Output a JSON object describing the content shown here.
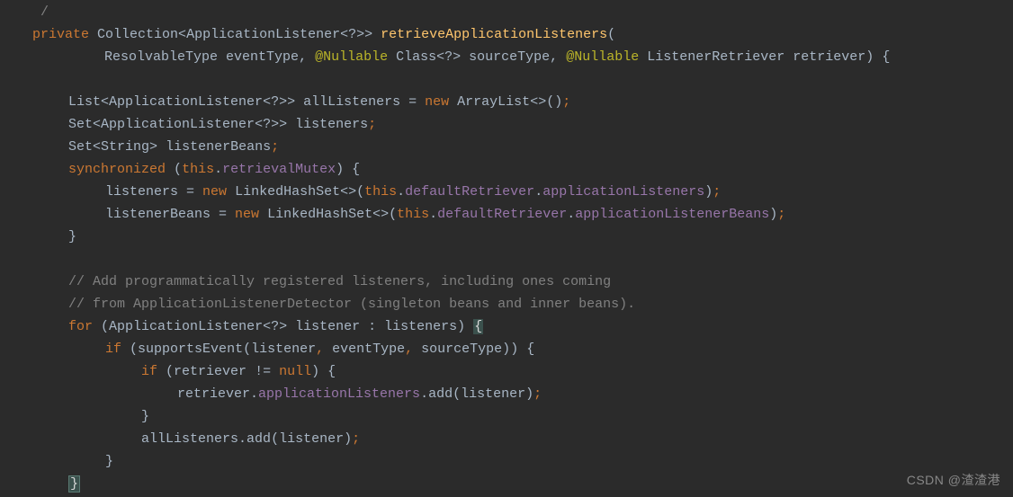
{
  "watermark": "CSDN @渣渣港",
  "tokens": {
    "private": "private",
    "new": "new",
    "this": "this",
    "synchronized": "synchronized",
    "for": "for",
    "if": "if",
    "null": "null",
    "ne": "!=",
    "Collection": "Collection",
    "ApplicationListener": "ApplicationListener",
    "ResolvableType": "ResolvableType",
    "Class": "Class",
    "ListenerRetriever": "ListenerRetriever",
    "List": "List",
    "Set": "Set",
    "String": "String",
    "ArrayList": "ArrayList",
    "LinkedHashSet": "LinkedHashSet",
    "Nullable": "@Nullable",
    "wildcardGen": "<?>",
    "wildcardGenGen": "<?>>",
    "diamond": "<>",
    "retrieveApplicationListeners": "retrieveApplicationListeners",
    "eventType": "eventType",
    "sourceType": "sourceType",
    "retriever": "retriever",
    "allListeners": "allListeners",
    "listeners": "listeners",
    "listenerBeans": "listenerBeans",
    "listener": "listener",
    "retrievalMutex": "retrievalMutex",
    "defaultRetriever": "defaultRetriever",
    "applicationListeners": "applicationListeners",
    "applicationListenerBeans": "applicationListenerBeans",
    "supportsEvent": "supportsEvent",
    "add": "add",
    "comment1": "// Add programmatically registered listeners, including ones coming",
    "comment2": "// from ApplicationListenerDetector (singleton beans and inner beans).",
    "topfrag": " /",
    "assign": " = ",
    "dot": ".",
    "comma": ", ",
    "semi": ";",
    "lp": "(",
    "rp": ")",
    "lb": "{",
    "rb": "}",
    "lt": "<",
    "gt": ">",
    "colonin": " : ",
    "sp": " "
  }
}
